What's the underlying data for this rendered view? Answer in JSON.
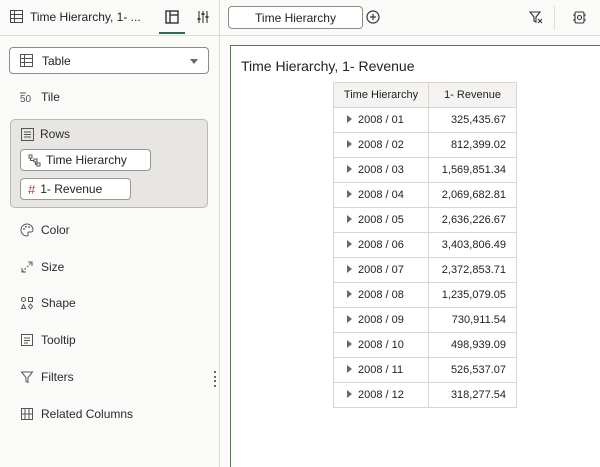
{
  "header": {
    "viz_title": "Time Hierarchy, 1- ...",
    "chip_label": "Time Hierarchy"
  },
  "panel": {
    "viz_type": "Table",
    "sections": {
      "tile": "Tile",
      "rows": "Rows",
      "color": "Color",
      "size": "Size",
      "shape": "Shape",
      "tooltip": "Tooltip",
      "filters": "Filters",
      "related": "Related Columns"
    },
    "rows_pills": [
      "Time Hierarchy",
      "1- Revenue"
    ]
  },
  "canvas": {
    "title": "Time Hierarchy, 1- Revenue",
    "columns": [
      "Time Hierarchy",
      "1- Revenue"
    ],
    "rows": [
      [
        "2008 / 01",
        "325,435.67"
      ],
      [
        "2008 / 02",
        "812,399.02"
      ],
      [
        "2008 / 03",
        "1,569,851.34"
      ],
      [
        "2008 / 04",
        "2,069,682.81"
      ],
      [
        "2008 / 05",
        "2,636,226.67"
      ],
      [
        "2008 / 06",
        "3,403,806.49"
      ],
      [
        "2008 / 07",
        "2,372,853.71"
      ],
      [
        "2008 / 08",
        "1,235,079.05"
      ],
      [
        "2008 / 09",
        "730,911.54"
      ],
      [
        "2008 / 10",
        "498,939.09"
      ],
      [
        "2008 / 11",
        "526,537.07"
      ],
      [
        "2008 / 12",
        "318,277.54"
      ]
    ]
  },
  "colors": {
    "accent": "#2d6a4f",
    "canvas_border": "#4d7a56",
    "measure_icon": "#c0392b"
  }
}
